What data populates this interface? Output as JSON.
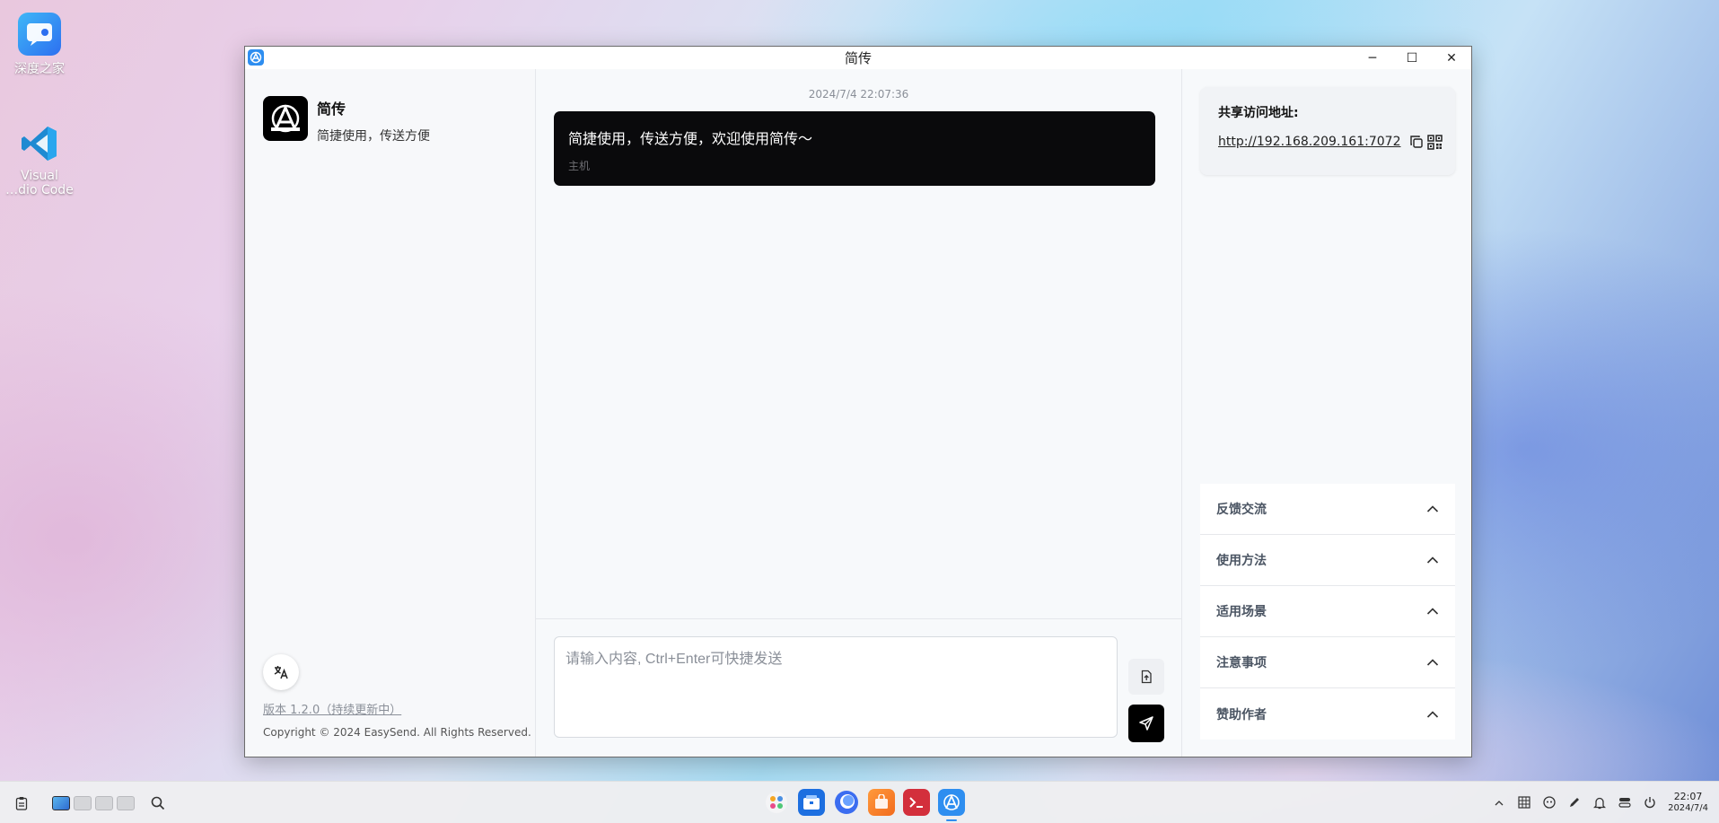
{
  "desktop": {
    "icons": [
      {
        "label": "深度之家"
      },
      {
        "label": "Visual\n…dio Code"
      }
    ]
  },
  "window": {
    "title": "简传",
    "controls": {
      "minimize": "─",
      "maximize": "☐",
      "close": "✕"
    }
  },
  "sidebar": {
    "app_name": "简传",
    "slogan": "简捷使用，传送方便",
    "version": "版本 1.2.0（持续更新中）",
    "copyright": "Copyright © 2024 EasySend. All Rights Reserved."
  },
  "chat": {
    "timestamp": "2024/7/4 22:07:36",
    "messages": [
      {
        "text": "简捷使用，传送方便，欢迎使用简传～",
        "sender": "主机"
      }
    ],
    "input": {
      "placeholder": "请输入内容, Ctrl+Enter可快捷发送",
      "value": ""
    }
  },
  "share": {
    "label": "共享访问地址:",
    "url": "http://192.168.209.161:7072"
  },
  "accordion": [
    {
      "label": "反馈交流"
    },
    {
      "label": "使用方法"
    },
    {
      "label": "适用场景"
    },
    {
      "label": "注意事项"
    },
    {
      "label": "赞助作者"
    }
  ],
  "taskbar": {
    "time": "22:07",
    "date": "2024/7/4",
    "dock_apps": [
      "launcher-icon",
      "file-manager-icon",
      "browser-icon",
      "app-store-icon",
      "terminal-icon",
      "easysend-icon"
    ]
  },
  "colors": {
    "accent": "#2e8ef0",
    "bubble": "#0a0a0c",
    "send_button": "#000000"
  }
}
